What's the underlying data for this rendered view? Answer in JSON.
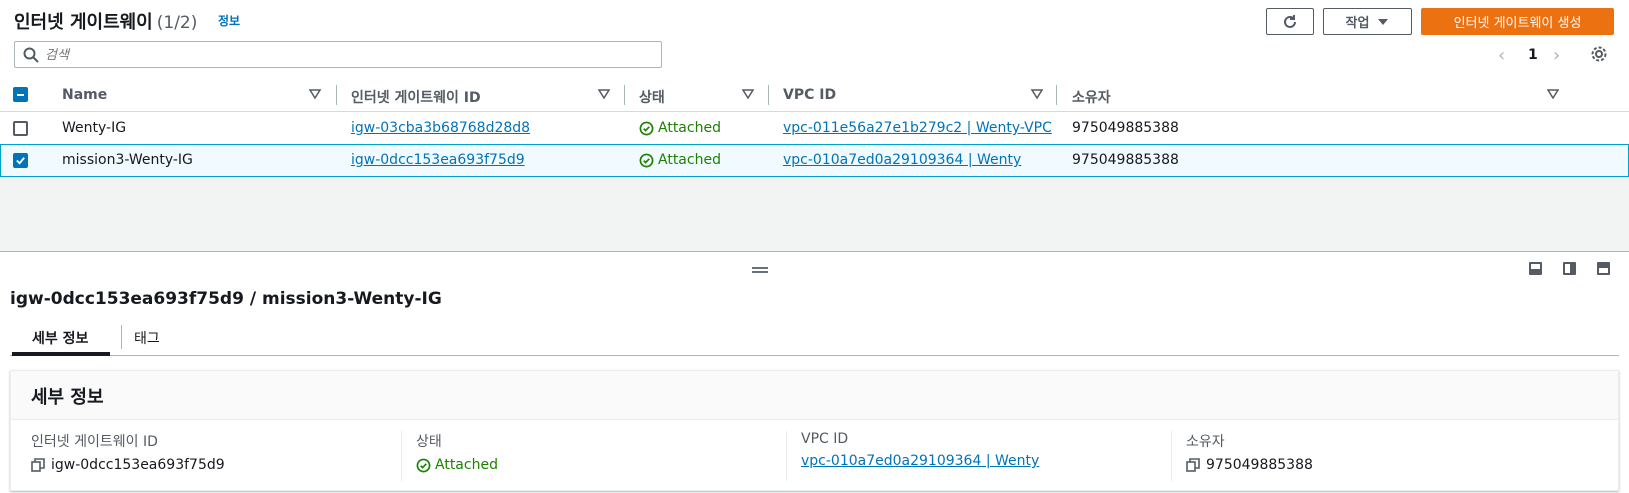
{
  "header": {
    "title": "인터넷 게이트웨이",
    "count": "(1/2)",
    "info": "정보",
    "actions_label": "작업",
    "create_label": "인터넷 게이트웨이 생성"
  },
  "search": {
    "placeholder": "검색"
  },
  "pagination": {
    "page": "1"
  },
  "table": {
    "columns": [
      "Name",
      "인터넷 게이트웨이 ID",
      "상태",
      "VPC ID",
      "소유자"
    ],
    "rows": [
      {
        "name": "Wenty-IG",
        "id": "igw-03cba3b68768d28d8",
        "status": "Attached",
        "vpc": "vpc-011e56a27e1b279c2 | Wenty-VPC",
        "owner": "975049885388",
        "selected": false
      },
      {
        "name": "mission3-Wenty-IG",
        "id": "igw-0dcc153ea693f75d9",
        "status": "Attached",
        "vpc": "vpc-010a7ed0a29109364 | Wenty",
        "owner": "975049885388",
        "selected": true
      }
    ]
  },
  "detail": {
    "title": "igw-0dcc153ea693f75d9 / mission3-Wenty-IG",
    "tabs": [
      "세부 정보",
      "태그"
    ],
    "panel_title": "세부 정보",
    "fields": [
      {
        "key": "인터넷 게이트웨이 ID",
        "value": "igw-0dcc153ea693f75d9"
      },
      {
        "key": "상태",
        "value": "Attached"
      },
      {
        "key": "VPC ID",
        "value": "vpc-010a7ed0a29109364 | Wenty"
      },
      {
        "key": "소유자",
        "value": "975049885388"
      }
    ]
  },
  "colors": {
    "accent": "#ec7211",
    "link": "#0073bb",
    "success": "#1d8102"
  }
}
